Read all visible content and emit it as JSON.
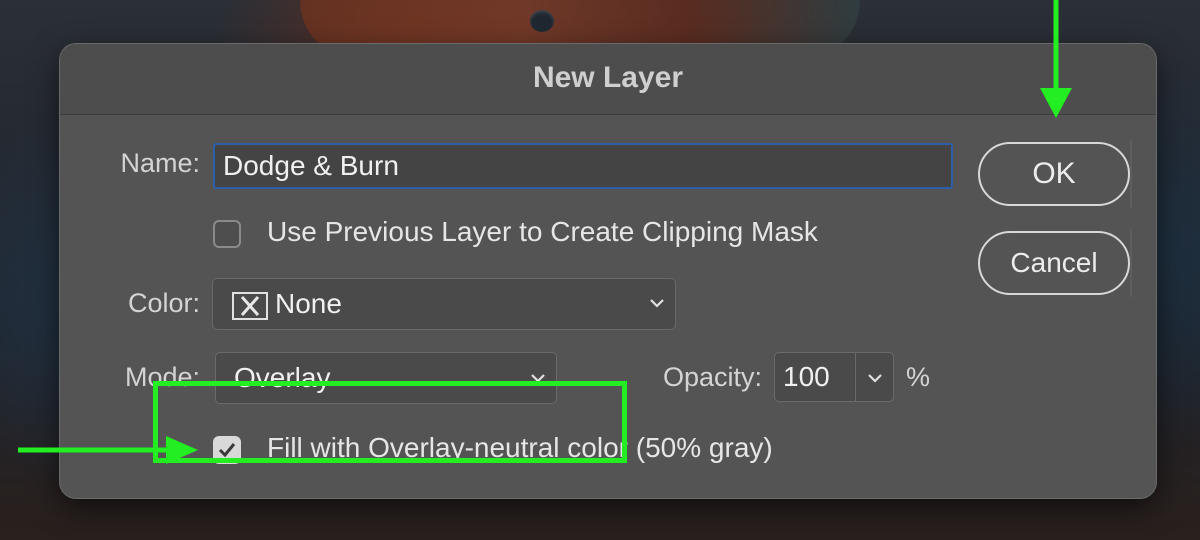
{
  "dialog": {
    "title": "New Layer",
    "name_label": "Name:",
    "name_value": "Dodge & Burn",
    "clipping_label": "Use Previous Layer to Create Clipping Mask",
    "clipping_checked": false,
    "color_label": "Color:",
    "color_value": "None",
    "mode_label": "Mode:",
    "mode_value": "Overlay",
    "opacity_label": "Opacity:",
    "opacity_value": "100",
    "opacity_unit": "%",
    "fill_label": "Fill with Overlay-neutral color (50% gray)",
    "fill_checked": true,
    "ok_label": "OK",
    "cancel_label": "Cancel"
  },
  "annotations": {
    "highlight_color": "#22ee22",
    "arrow_color": "#22ee22",
    "arrows": [
      "arrow-down-to-ok",
      "arrow-right-to-fill-checkbox"
    ]
  },
  "icons": [
    "none-swatch-icon",
    "chevron-down-icon",
    "checkmark-icon"
  ]
}
